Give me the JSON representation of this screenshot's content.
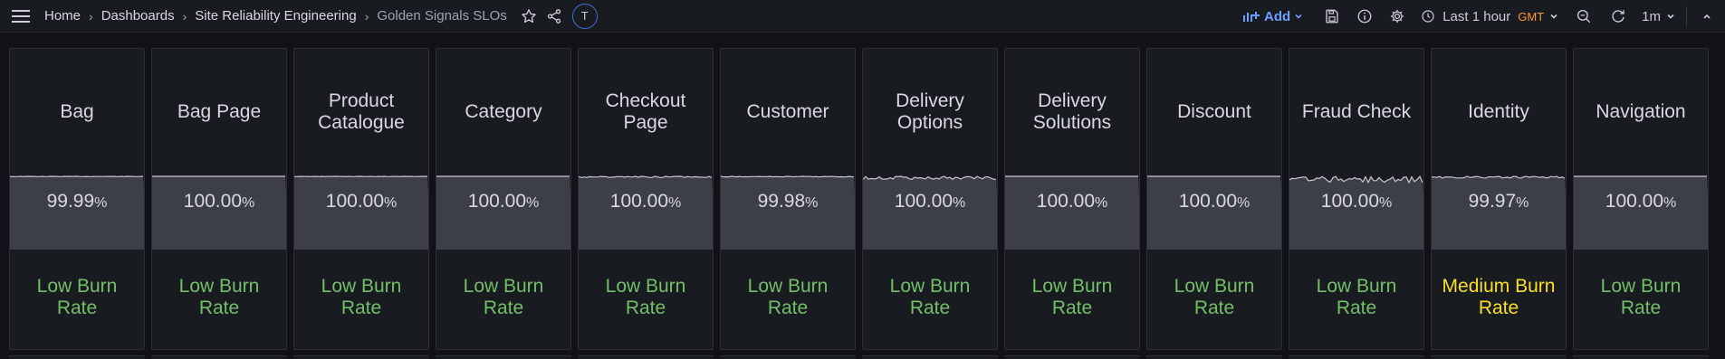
{
  "breadcrumb": [
    "Home",
    "Dashboards",
    "Site Reliability Engineering",
    "Golden Signals SLOs"
  ],
  "user": {
    "initial": "T"
  },
  "toolbar": {
    "add_label": "Add",
    "time_range": "Last 1 hour",
    "timezone": "GMT",
    "refresh_interval": "1m"
  },
  "colors": {
    "low": "#73bf69",
    "medium": "#fade2a",
    "accent": "#6e9fff",
    "tz": "#ff9830"
  },
  "panels": [
    {
      "title": "Bag",
      "value": "99.99",
      "unit": "%",
      "status": "Low Burn Rate",
      "level": "low",
      "noise": 0.05
    },
    {
      "title": "Bag Page",
      "value": "100.00",
      "unit": "%",
      "status": "Low Burn Rate",
      "level": "low",
      "noise": 0.0
    },
    {
      "title": "Product Catalogue",
      "value": "100.00",
      "unit": "%",
      "status": "Low Burn Rate",
      "level": "low",
      "noise": 0.05
    },
    {
      "title": "Category",
      "value": "100.00",
      "unit": "%",
      "status": "Low Burn Rate",
      "level": "low",
      "noise": 0.0
    },
    {
      "title": "Checkout Page",
      "value": "100.00",
      "unit": "%",
      "status": "Low Burn Rate",
      "level": "low",
      "noise": 0.2
    },
    {
      "title": "Customer",
      "value": "99.98",
      "unit": "%",
      "status": "Low Burn Rate",
      "level": "low",
      "noise": 0.1
    },
    {
      "title": "Delivery Options",
      "value": "100.00",
      "unit": "%",
      "status": "Low Burn Rate",
      "level": "low",
      "noise": 0.5
    },
    {
      "title": "Delivery Solutions",
      "value": "100.00",
      "unit": "%",
      "status": "Low Burn Rate",
      "level": "low",
      "noise": 0.0
    },
    {
      "title": "Discount",
      "value": "100.00",
      "unit": "%",
      "status": "Low Burn Rate",
      "level": "low",
      "noise": 0.0
    },
    {
      "title": "Fraud Check",
      "value": "100.00",
      "unit": "%",
      "status": "Low Burn Rate",
      "level": "low",
      "noise": 1.0
    },
    {
      "title": "Identity",
      "value": "99.97",
      "unit": "%",
      "status": "Medium Burn Rate",
      "level": "medium",
      "noise": 0.3
    },
    {
      "title": "Navigation",
      "value": "100.00",
      "unit": "%",
      "status": "Low Burn Rate",
      "level": "low",
      "noise": 0.0
    }
  ]
}
